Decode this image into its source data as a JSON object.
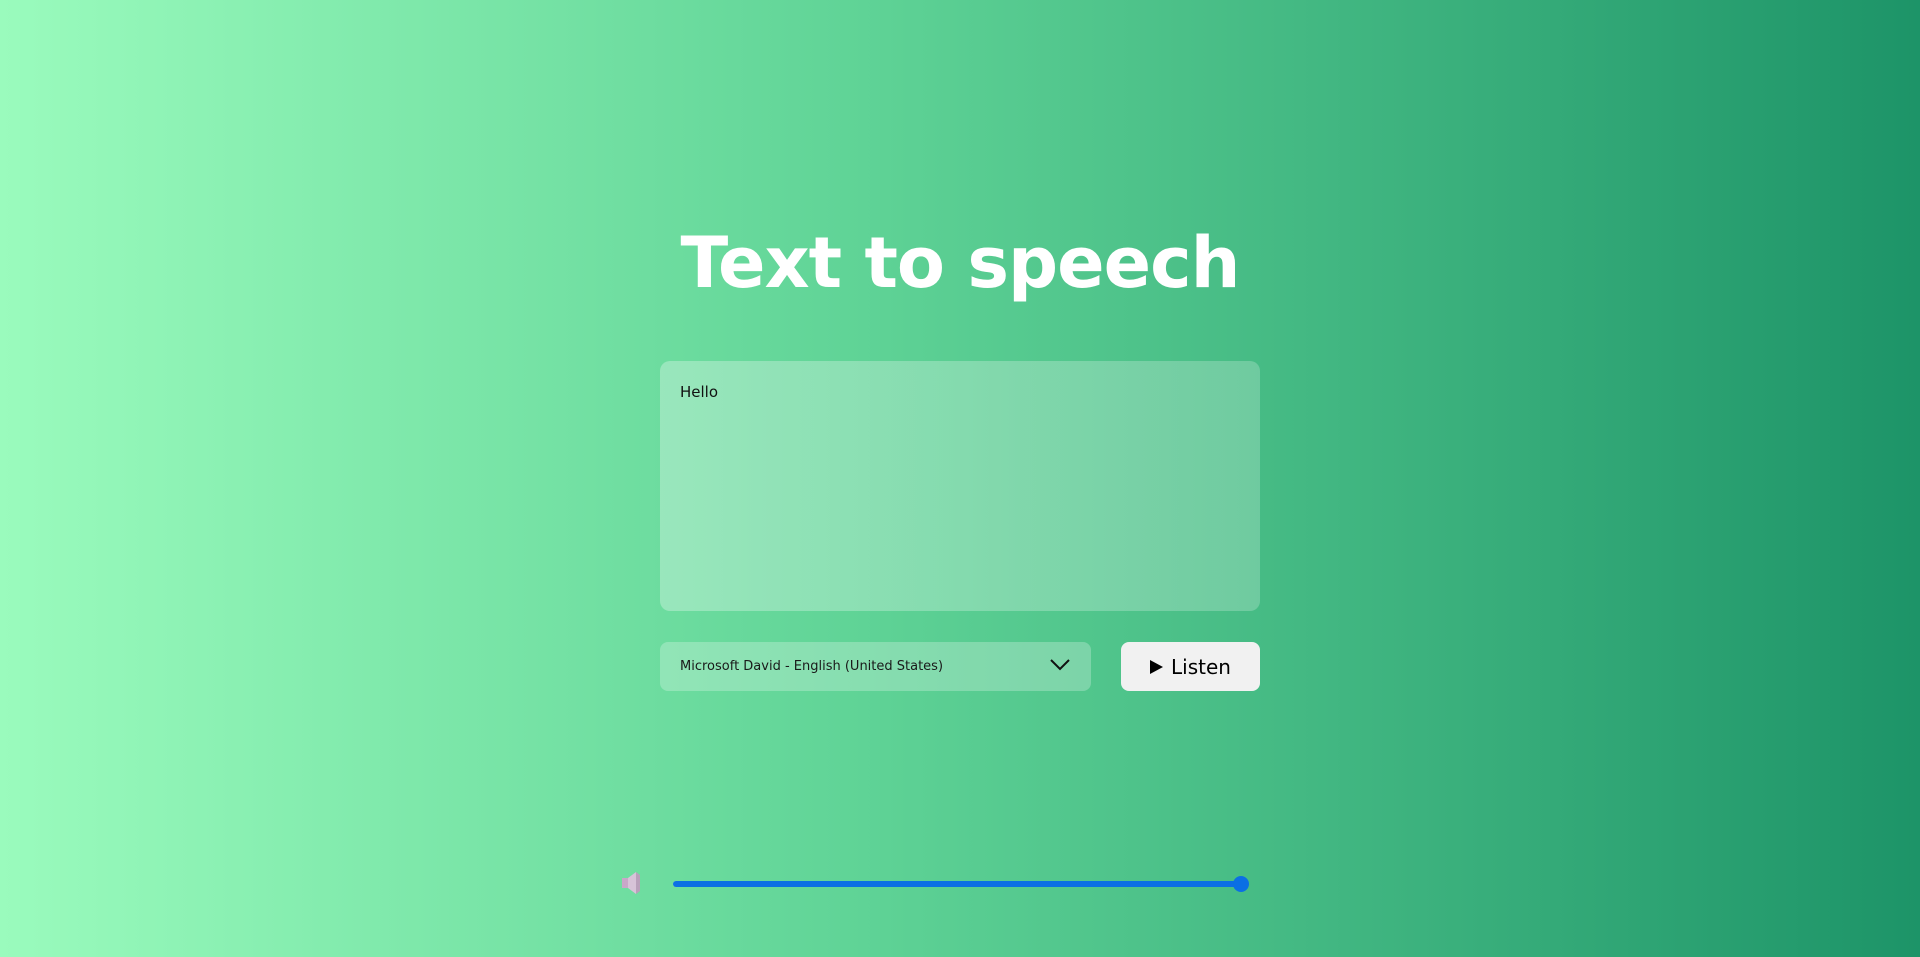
{
  "header": {
    "title": "Text to speech"
  },
  "editor": {
    "value": "Hello"
  },
  "voice_select": {
    "selected": "Microsoft David - English (United States)",
    "icon": "chevron-down-icon"
  },
  "listen_button": {
    "label": "Listen",
    "icon": "play-icon"
  },
  "volume": {
    "icon": "speaker-icon",
    "level": 1.0,
    "accent_color": "#0b6fe4"
  }
}
